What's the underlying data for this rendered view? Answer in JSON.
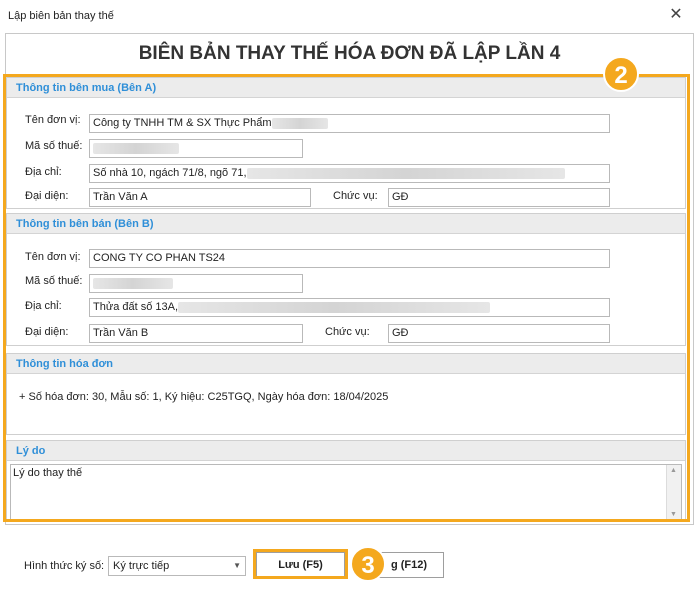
{
  "window": {
    "title": "Lập biên bản thay thế",
    "close": "✕"
  },
  "heading": "BIÊN BẢN THAY THẾ HÓA ĐƠN ĐÃ LẬP LẦN 4",
  "buyer": {
    "section_title": "Thông tin bên mua (Bên A)",
    "unit_label": "Tên đơn vị:",
    "unit_value": "Công ty TNHH TM & SX Thực Phẩm",
    "tax_label": "Mã số thuế:",
    "address_label": "Địa chỉ:",
    "address_value": "Số nhà 10, ngách 71/8, ngõ 71,",
    "rep_label": "Đại diện:",
    "rep_value": "Trần Văn A",
    "position_label": "Chức vụ:",
    "position_value": "GĐ"
  },
  "seller": {
    "section_title": "Thông tin bên bán (Bên B)",
    "unit_label": "Tên đơn vị:",
    "unit_value": "CONG TY CO PHAN TS24",
    "tax_label": "Mã số thuế:",
    "address_label": "Địa chỉ:",
    "address_value": "Thửa đất số 13A,",
    "rep_label": "Đại diện:",
    "rep_value": "Trần Văn B",
    "position_label": "Chức vụ:",
    "position_value": "GĐ"
  },
  "invoice": {
    "section_title": "Thông tin hóa đơn",
    "detail": "+ Số hóa đơn: 30, Mẫu số: 1, Ký hiệu: C25TGQ, Ngày hóa đơn: 18/04/2025"
  },
  "reason": {
    "section_title": "Lý do",
    "value": "Lý do thay thế"
  },
  "footer": {
    "sign_label": "Hình thức ký số:",
    "sign_value": "Ký trực tiếp",
    "save_label": "Lưu (F5)",
    "close_label": "g (F12)"
  },
  "badges": {
    "step2": "2",
    "step3": "3"
  },
  "colors": {
    "accent": "#f4a81e",
    "section_title": "#2f8fd8"
  },
  "icons": {
    "close": "close-icon",
    "dropdown": "chevron-down-icon"
  }
}
